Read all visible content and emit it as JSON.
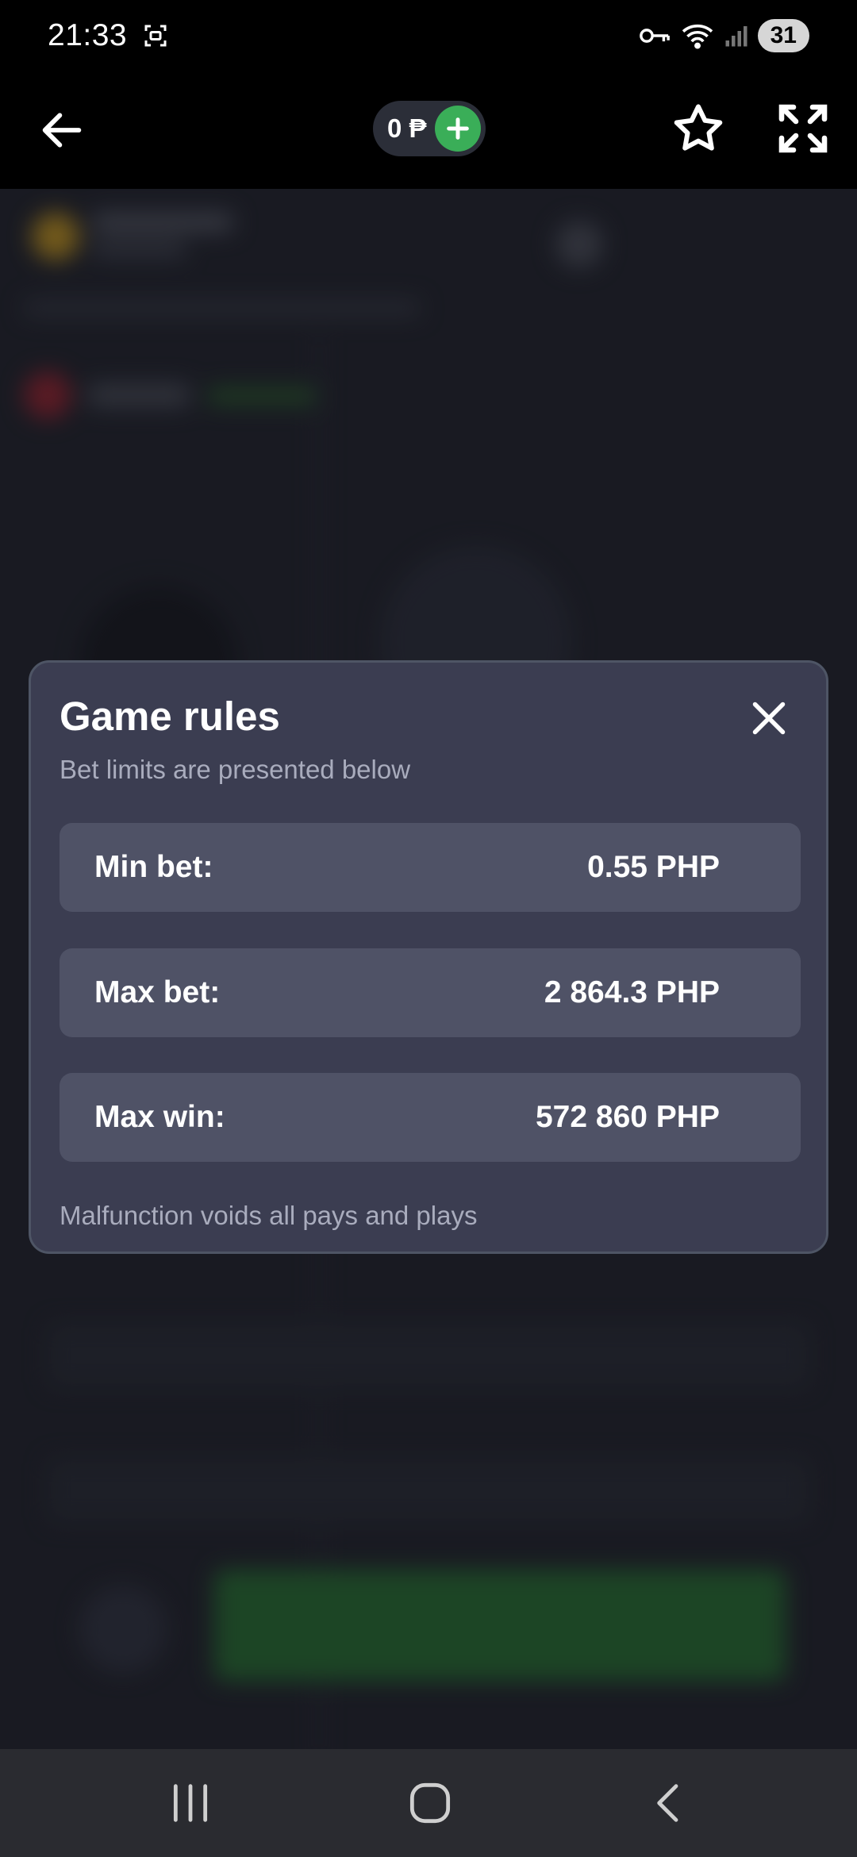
{
  "status_bar": {
    "time": "21:33",
    "battery": "31",
    "icons": [
      "screenshot-icon",
      "vpn-key-icon",
      "wifi-icon",
      "signal-icon"
    ]
  },
  "app_bar": {
    "balance": "0 ₱",
    "icons": [
      "back-arrow-icon",
      "plus-icon",
      "star-icon",
      "fullscreen-icon"
    ]
  },
  "modal": {
    "title": "Game rules",
    "subtitle": "Bet limits are presented below",
    "limits": [
      {
        "label": "Min bet:",
        "value": "0.55 PHP"
      },
      {
        "label": "Max bet:",
        "value": "2 864.3 PHP"
      },
      {
        "label": "Max win:",
        "value": "572 860 PHP"
      }
    ],
    "footer": "Malfunction voids all pays and plays"
  },
  "nav_bar": {
    "icons": [
      "recents-icon",
      "home-icon",
      "back-icon"
    ]
  },
  "colors": {
    "accent_green": "#3aae58",
    "modal_bg": "#3b3d51",
    "row_bg": "#4f5266",
    "muted_text": "#a9acbd"
  }
}
